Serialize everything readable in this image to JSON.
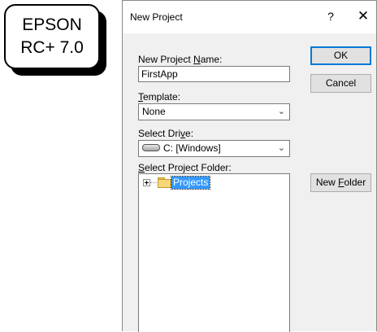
{
  "badge": {
    "line1": "EPSON",
    "line2": "RC+ 7.0"
  },
  "dialog": {
    "title": "New Project",
    "help_label": "?",
    "close_label": "✕",
    "name_label_pre": "New Project ",
    "name_label_ul": "N",
    "name_label_post": "ame:",
    "name_value": "FirstApp",
    "template_label_ul": "T",
    "template_label_post": "emplate:",
    "template_value": "None",
    "drive_label_pre": "Select Dri",
    "drive_label_ul": "v",
    "drive_label_post": "e:",
    "drive_value": "C: [Windows]",
    "folder_label_ul": "S",
    "folder_label_post": "elect Project Folder:",
    "tree_item": "Projects",
    "ok_label": "OK",
    "cancel_label": "Cancel",
    "new_folder_pre": "New ",
    "new_folder_ul": "F",
    "new_folder_post": "older"
  }
}
